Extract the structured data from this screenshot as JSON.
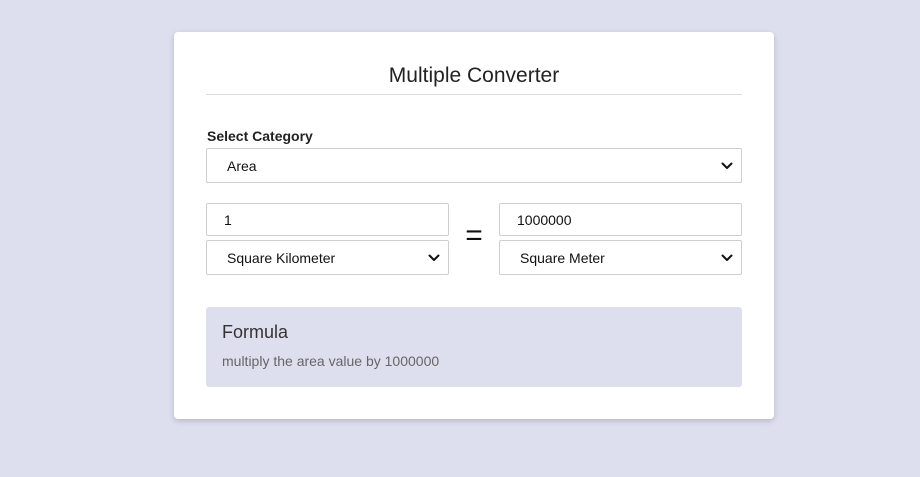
{
  "app": {
    "title": "Multiple Converter"
  },
  "category": {
    "label": "Select Category",
    "selected": "Area"
  },
  "converter": {
    "from_value": "1",
    "from_unit": "Square Kilometer",
    "equals_symbol": "=",
    "to_value": "1000000",
    "to_unit": "Square Meter"
  },
  "formula": {
    "heading": "Formula",
    "text": "multiply the area value by 1000000"
  },
  "colors": {
    "page_background": "#dddfef",
    "card_background": "#ffffff",
    "formula_background": "#dddfef"
  },
  "icons": {
    "select_arrow": "chevron-down-icon"
  }
}
